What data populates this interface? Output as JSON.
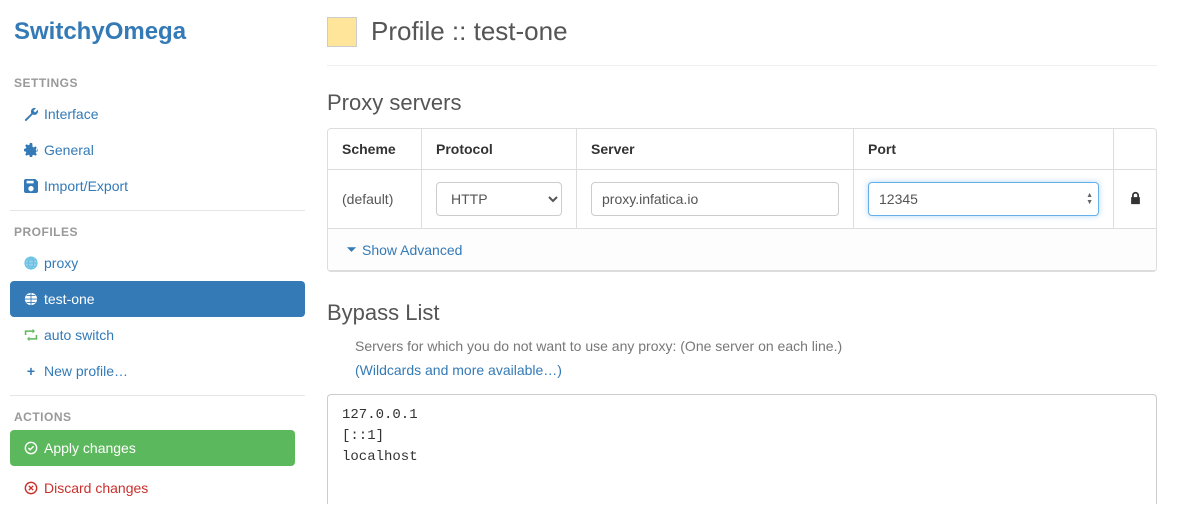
{
  "app_title": "SwitchyOmega",
  "sidebar": {
    "settings_header": "SETTINGS",
    "settings": [
      {
        "label": "Interface"
      },
      {
        "label": "General"
      },
      {
        "label": "Import/Export"
      }
    ],
    "profiles_header": "PROFILES",
    "profiles": [
      {
        "label": "proxy",
        "active": false
      },
      {
        "label": "test-one",
        "active": true
      },
      {
        "label": "auto switch",
        "active": false
      }
    ],
    "new_profile": "New profile…",
    "actions_header": "ACTIONS",
    "apply": "Apply changes",
    "discard": "Discard changes"
  },
  "profile": {
    "title": "Profile :: test-one",
    "color": "#ffe599"
  },
  "proxy": {
    "heading": "Proxy servers",
    "cols": {
      "scheme": "Scheme",
      "protocol": "Protocol",
      "server": "Server",
      "port": "Port"
    },
    "row": {
      "scheme": "(default)",
      "protocol": "HTTP",
      "server": "proxy.infatica.io",
      "port": "12345"
    },
    "show_advanced": "Show Advanced"
  },
  "bypass": {
    "heading": "Bypass List",
    "help": "Servers for which you do not want to use any proxy: (One server on each line.)",
    "wildcards": "(Wildcards and more available…)",
    "value": "127.0.0.1\n[::1]\nlocalhost"
  }
}
